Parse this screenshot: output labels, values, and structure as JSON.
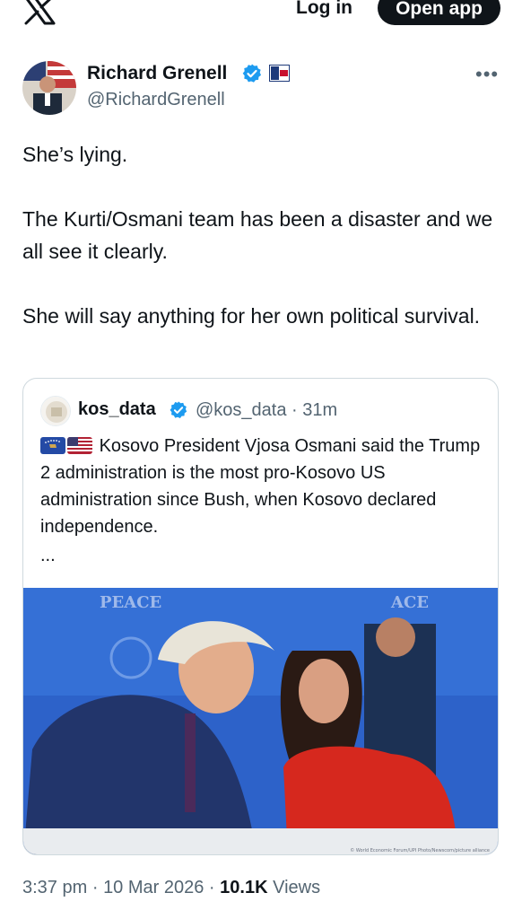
{
  "topbar": {
    "logo_icon": "x-logo-icon",
    "login_label": "Log in",
    "open_app_label": "Open app"
  },
  "tweet": {
    "author_name": "Richard Grenell",
    "author_handle": "@RichardGrenell",
    "more_label": "•••",
    "paragraphs": [
      "She’s lying.",
      "The Kurti/Osmani team has been a disaster and we all see it clearly.",
      "She will say anything for her own political survival."
    ],
    "time": "3:37 pm",
    "date": "10 Mar 2026",
    "views_count": "10.1K",
    "views_label": "Views",
    "separator": "·"
  },
  "quote": {
    "name": "kos_data",
    "handle": "@kos_data",
    "age": "31m",
    "text": "Kosovo President Vjosa Osmani said the Trump 2 administration is the most pro-Kosovo US administration since Bush, when Kosovo declared independence.",
    "ellipsis": "...",
    "photo_banner_text": "PEACE",
    "photo_credit": "© World Economic Forum/UPI Photo/Newscom/picture alliance"
  },
  "colors": {
    "accent": "#1d9bf0",
    "text": "#0f1419",
    "secondary": "#536471",
    "border": "#cfd9de"
  }
}
